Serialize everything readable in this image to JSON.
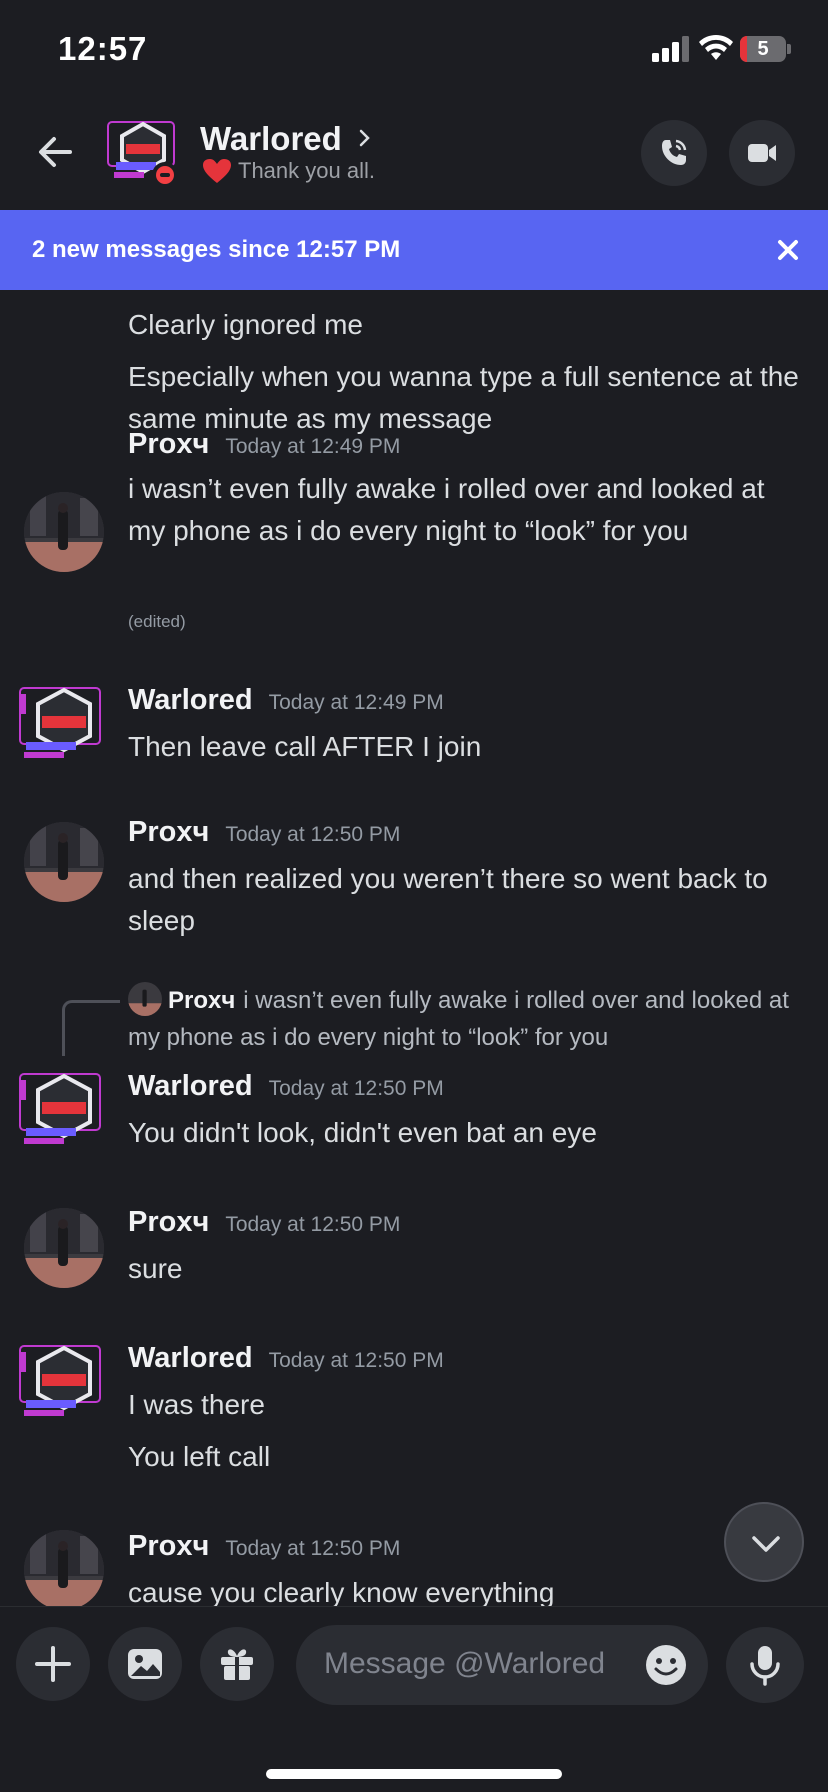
{
  "status_bar": {
    "time": "12:57",
    "battery": "5",
    "battery_level": 0.05
  },
  "header": {
    "name": "Warlored",
    "custom_status": "Thank you all."
  },
  "banner": {
    "text": "2 new messages since 12:57 PM"
  },
  "messages": {
    "m0": {
      "line1": "Clearly ignored me",
      "line2": "Especially when you wanna type a full sentence at the same minute as my message"
    },
    "m1": {
      "author": "Proxч",
      "time": "Today at 12:49 PM",
      "text": "i wasn’t even fully awake i rolled over and looked at my phone as i do every night to “look” for you",
      "edited": "(edited)"
    },
    "m2": {
      "author": "Warlored",
      "time": "Today at 12:49 PM",
      "text": "Then leave call AFTER I join"
    },
    "m3": {
      "author": "Proxч",
      "time": "Today at 12:50 PM",
      "text": "and then realized you weren’t there so went back to sleep"
    },
    "m4": {
      "reply_author": "Proxч",
      "reply_text": "i wasn’t even fully awake i rolled over and looked at my phone as i do every night to “look” for you",
      "author": "Warlored",
      "time": "Today at 12:50 PM",
      "text": "You didn't look, didn't even bat an eye"
    },
    "m5": {
      "author": "Proxч",
      "time": "Today at 12:50 PM",
      "text": "sure"
    },
    "m6": {
      "author": "Warlored",
      "time": "Today at 12:50 PM",
      "line1": "I was there",
      "line2": "You left call"
    },
    "m7": {
      "author": "Proxч",
      "time": "Today at 12:50 PM",
      "text": "cause you clearly know everything"
    }
  },
  "composer": {
    "placeholder": "Message @Warlored"
  },
  "colors": {
    "accent": "#5865f2",
    "background": "#1c1d22",
    "dnd": "#f23f43"
  },
  "icons": [
    "back-arrow-icon",
    "phone-call-icon",
    "video-camera-icon",
    "close-icon",
    "chevron-down-icon",
    "plus-icon",
    "image-icon",
    "gift-icon",
    "emoji-icon",
    "microphone-icon",
    "heart-icon"
  ]
}
